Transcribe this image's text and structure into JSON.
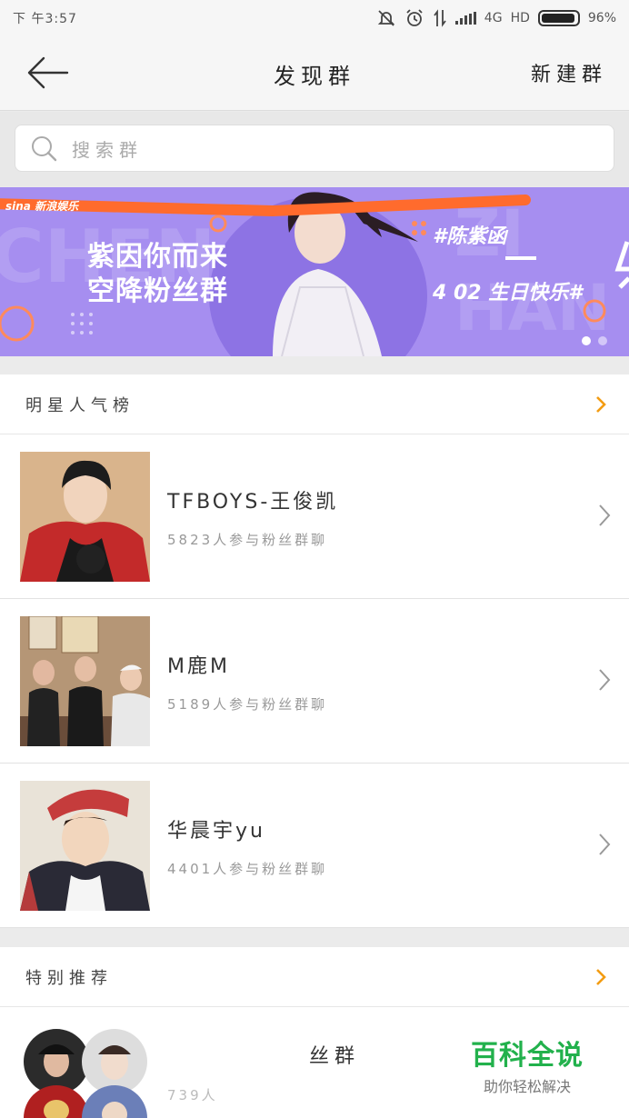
{
  "status": {
    "time": "下 午3:57",
    "network": "4G",
    "hd": "HD",
    "battery": "96%",
    "battery_level": 0.96
  },
  "nav": {
    "title": "发现群",
    "new_group": "新建群"
  },
  "search": {
    "placeholder": "搜索群"
  },
  "banner": {
    "brand": "sina 新浪娱乐",
    "slogan_line1": "紫因你而来",
    "slogan_line2": "空降粉丝群",
    "hashtag": "#陈紫函",
    "date_line": "4 02 生日快乐#",
    "bg_text_left": "CHEN",
    "bg_text_right": "ZI HAN"
  },
  "star_ranking": {
    "title": "明星人气榜",
    "items": [
      {
        "name": "TFBOYS-王俊凯",
        "stats": "5823人参与粉丝群聊"
      },
      {
        "name": "M鹿M",
        "stats": "5189人参与粉丝群聊"
      },
      {
        "name": "华晨宇yu",
        "stats": "4401人参与粉丝群聊"
      }
    ]
  },
  "special": {
    "title": "特别推荐",
    "item": {
      "name_partial": "丝群",
      "stats_partial": "739人"
    }
  },
  "watermark": {
    "title": "百科全说",
    "subtitle": "助你轻松解决"
  },
  "colors": {
    "accent": "#f39c12",
    "banner": "#a68ef0",
    "watermark_green": "#22b14c"
  }
}
